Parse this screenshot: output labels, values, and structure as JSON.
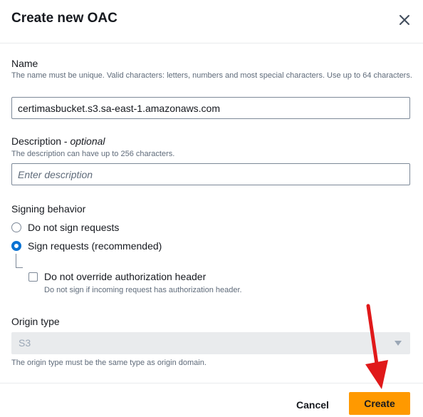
{
  "dialog": {
    "title": "Create new OAC"
  },
  "name": {
    "label": "Name",
    "hint": "The name must be unique. Valid characters: letters, numbers and most special characters. Use up to 64 characters.",
    "value": "certimasbucket.s3.sa-east-1.amazonaws.com"
  },
  "description": {
    "label": "Description",
    "optional": "optional",
    "separator": " - ",
    "hint": "The description can have up to 256 characters.",
    "placeholder": "Enter description",
    "value": ""
  },
  "signing": {
    "label": "Signing behavior",
    "options": [
      {
        "label": "Do not sign requests",
        "selected": false
      },
      {
        "label": "Sign requests (recommended)",
        "selected": true
      }
    ],
    "override": {
      "label": "Do not override authorization header",
      "hint": "Do not sign if incoming request has authorization header.",
      "checked": false
    }
  },
  "origin": {
    "label": "Origin type",
    "value": "S3",
    "hint": "The origin type must be the same type as origin domain.",
    "disabled": true
  },
  "footer": {
    "cancel_label": "Cancel",
    "create_label": "Create"
  },
  "colors": {
    "primary_button": "#ff9900",
    "radio_selected": "#0972d3",
    "annotation_arrow": "#e0191a"
  }
}
